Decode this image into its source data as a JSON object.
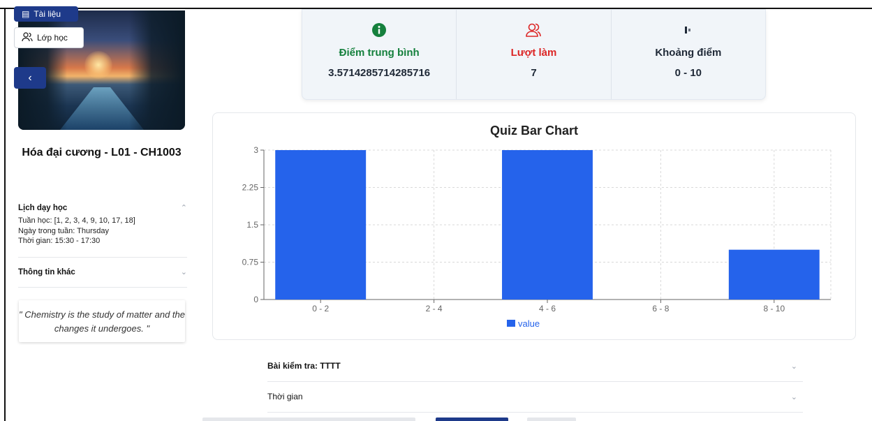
{
  "sidebar": {
    "top_button_label": "Tài liệu",
    "class_button_label": "Lớp học",
    "back_icon": "chevron-left",
    "course_title": "Hóa đại cương - L01 - CH1003",
    "schedule": {
      "title": "Lịch dạy học",
      "weeks": "Tuần học: [1, 2, 3, 4, 9, 10, 17, 18]",
      "day": "Ngày trong tuần: Thursday",
      "time": "Thời gian: 15:30 - 17:30"
    },
    "other_info_title": "Thông tin khác",
    "quote": "\" Chemistry is the study of matter and the changes it undergoes. \""
  },
  "stats": [
    {
      "icon": "info-icon",
      "label": "Điểm trung bình",
      "value": "3.5714285714285716",
      "color": "#15803d"
    },
    {
      "icon": "users-icon",
      "label": "Lượt làm",
      "value": "7",
      "color": "#dc2626"
    },
    {
      "icon": "range-icon",
      "label": "Khoảng điểm",
      "value": "0 - 10",
      "color": "#1f2937"
    }
  ],
  "chart_data": {
    "type": "bar",
    "title": "Quiz Bar Chart",
    "categories": [
      "0 - 2",
      "2 - 4",
      "4 - 6",
      "6 - 8",
      "8 - 10"
    ],
    "series": [
      {
        "name": "value",
        "values": [
          3,
          0,
          3,
          0,
          1
        ]
      }
    ],
    "ylim": [
      0,
      3
    ],
    "yticks": [
      "0",
      "0.75",
      "1.5",
      "2.25",
      "3"
    ],
    "grid": true,
    "legend": "bottom",
    "bar_color": "#2563eb"
  },
  "accordion": {
    "quiz_label": "Bài kiểm tra: TTTT",
    "time_label": "Thời gian"
  }
}
